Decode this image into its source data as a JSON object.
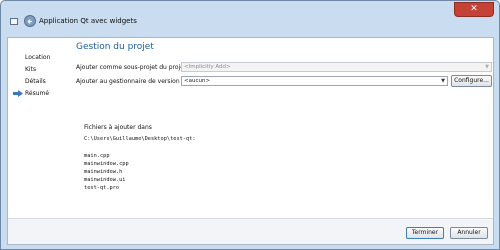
{
  "window": {
    "title": "Application Qt avec widgets",
    "close_glyph": "✕",
    "icons": [
      "app-window-icon",
      "back-arrow-icon"
    ],
    "colors": {
      "frame": "#c9dcf0",
      "title_accent": "#1b5ea3",
      "close": "#c54237"
    }
  },
  "nav": {
    "items": [
      {
        "label": "Location",
        "active": false
      },
      {
        "label": "Kits",
        "active": false
      },
      {
        "label": "Détails",
        "active": false
      },
      {
        "label": "Résumé",
        "active": true
      }
    ]
  },
  "page": {
    "title": "Gestion du projet",
    "subproject_label": "Ajouter comme sous-projet du projet :",
    "subproject_value": "<Implicitly Add>",
    "vcs_label": "Ajouter au gestionnaire de version :",
    "vcs_value": "<aucun>",
    "configure_button": "Configure...",
    "files_heading": "Fichiers à ajouter dans",
    "files_path": "C:\\Users\\Guillaume\\Desktop\\test-qt:",
    "files": [
      "main.cpp",
      "mainwindow.cpp",
      "mainwindow.h",
      "mainwindow.ui",
      "test-qt.pro"
    ]
  },
  "buttons": {
    "finish": "Terminer",
    "cancel": "Annuler"
  }
}
